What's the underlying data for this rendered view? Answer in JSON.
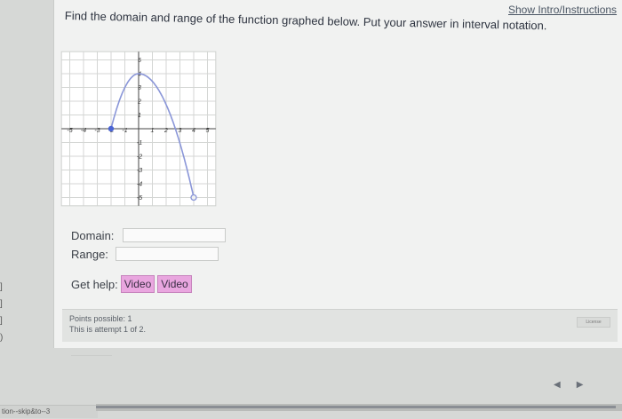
{
  "header": {
    "intro_link": "Show Intro/Instructions"
  },
  "question": {
    "text": "Find the domain and range of the function graphed below. Put your answer in interval notation."
  },
  "graph": {
    "x_ticks": [
      "-5",
      "-4",
      "-3",
      "-2",
      "-1",
      "1",
      "2",
      "3",
      "4",
      "5"
    ],
    "y_ticks": [
      "5",
      "4",
      "3",
      "2",
      "1",
      "-1",
      "-2",
      "-3",
      "-4",
      "-5"
    ],
    "curve_color": "#8a96d8",
    "closed_point": {
      "x": -2,
      "y": 0
    },
    "open_point": {
      "x": 4,
      "y": -5
    }
  },
  "answers": {
    "domain_label": "Domain:",
    "range_label": "Range:",
    "domain_value": "",
    "range_value": ""
  },
  "help": {
    "label": "Get help:",
    "video1": "Video",
    "video2": "Video"
  },
  "points": {
    "possible": "Points possible: 1",
    "attempt": "This is attempt 1 of 2."
  },
  "license": "License",
  "left_marks": [
    "]",
    "]",
    "]",
    ")"
  ],
  "status_text": "tion--skip&to--3",
  "nav": {
    "prev": "◀",
    "next": "▶"
  }
}
